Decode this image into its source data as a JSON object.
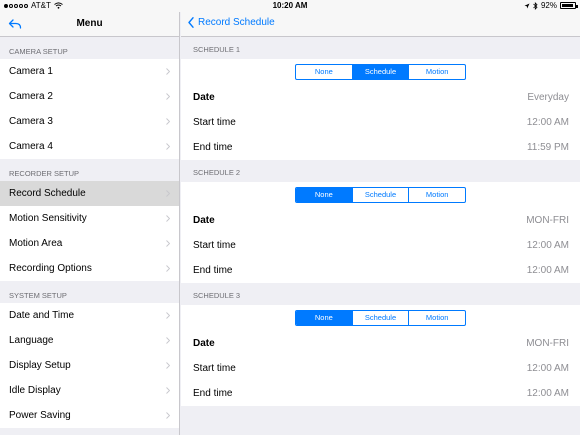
{
  "status": {
    "carrier": "AT&T",
    "time": "10:20 AM",
    "battery": "92%",
    "battery_level": 0.92
  },
  "sidebar": {
    "title": "Menu",
    "sections": [
      {
        "header": "CAMERA SETUP",
        "items": [
          "Camera 1",
          "Camera 2",
          "Camera 3",
          "Camera 4"
        ]
      },
      {
        "header": "RECORDER SETUP",
        "items": [
          "Record Schedule",
          "Motion Sensitivity",
          "Motion Area",
          "Recording Options"
        ]
      },
      {
        "header": "SYSTEM SETUP",
        "items": [
          "Date and Time",
          "Language",
          "Display Setup",
          "Idle Display",
          "Power Saving"
        ]
      }
    ]
  },
  "main": {
    "back_label": "Record Schedule",
    "schedules": [
      {
        "header": "SCHEDULE 1",
        "segments": [
          "None",
          "Schedule",
          "Motion"
        ],
        "selected": "Schedule",
        "rows": [
          {
            "label": "Date",
            "value": "Everyday"
          },
          {
            "label": "Start time",
            "value": "12:00 AM"
          },
          {
            "label": "End time",
            "value": "11:59 PM"
          }
        ]
      },
      {
        "header": "SCHEDULE 2",
        "segments": [
          "None",
          "Schedule",
          "Motion"
        ],
        "selected": "None",
        "rows": [
          {
            "label": "Date",
            "value": "MON-FRI"
          },
          {
            "label": "Start time",
            "value": "12:00 AM"
          },
          {
            "label": "End time",
            "value": "12:00 AM"
          }
        ]
      },
      {
        "header": "SCHEDULE 3",
        "segments": [
          "None",
          "Schedule",
          "Motion"
        ],
        "selected": "None",
        "rows": [
          {
            "label": "Date",
            "value": "MON-FRI"
          },
          {
            "label": "Start time",
            "value": "12:00 AM"
          },
          {
            "label": "End time",
            "value": "12:00 AM"
          }
        ]
      }
    ]
  },
  "colors": {
    "accent": "#007aff",
    "background": "#efeff4",
    "selected_row": "#d9d9d9",
    "secondary_text": "#8e8e93"
  }
}
